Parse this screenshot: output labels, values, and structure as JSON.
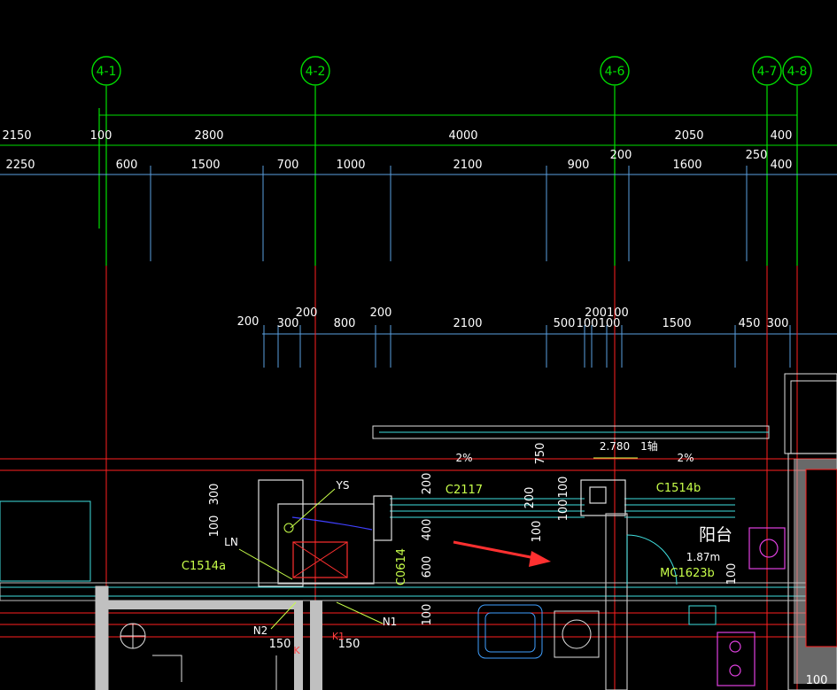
{
  "axes": [
    {
      "id": "4-1",
      "label": "4-1"
    },
    {
      "id": "4-2",
      "label": "4-2"
    },
    {
      "id": "4-6",
      "label": "4-6"
    },
    {
      "id": "4-7",
      "label": "4-7"
    },
    {
      "id": "4-8",
      "label": "4-8"
    }
  ],
  "dimensions": {
    "row1": [
      "2150",
      "100",
      "2800",
      "4000",
      "2050",
      "400"
    ],
    "row2": [
      "2250",
      "600",
      "1500",
      "700",
      "1000",
      "2100",
      "900",
      "200",
      "1600",
      "250",
      "400"
    ],
    "row3": [
      "200",
      "300",
      "200",
      "800",
      "200",
      "2100",
      "500",
      "100",
      "100",
      "200100",
      "1500",
      "450",
      "300"
    ],
    "vertical": [
      "300",
      "100",
      "200",
      "400",
      "600",
      "100",
      "750",
      "200",
      "100",
      "100",
      "100",
      "100"
    ],
    "small": [
      "150",
      "150",
      "100"
    ]
  },
  "annotations": {
    "slope_left": "2%",
    "slope_right": "2%",
    "elevation": "2.780",
    "axis_ref": "1轴",
    "window_c2117": "C2117",
    "window_c1514b": "C1514b",
    "window_c1514a": "C1514a",
    "window_c0614": "C0614",
    "balcony": "阳台",
    "balcony_elev": "1.87m",
    "door_mc": "MC1623b",
    "ys": "YS",
    "ln": "LN",
    "n1": "N1",
    "n2": "N2",
    "k": "K",
    "k1": "K1"
  },
  "colors": {
    "background": "#000000",
    "axis_line": "#00e000",
    "grid_red": "#ff2020",
    "dim_blue": "#5aa0e0",
    "wall_cyan": "#40e0e0",
    "wall_fill": "#c0c0c0",
    "arrow": "#ff3030",
    "magenta": "#e040e0"
  }
}
